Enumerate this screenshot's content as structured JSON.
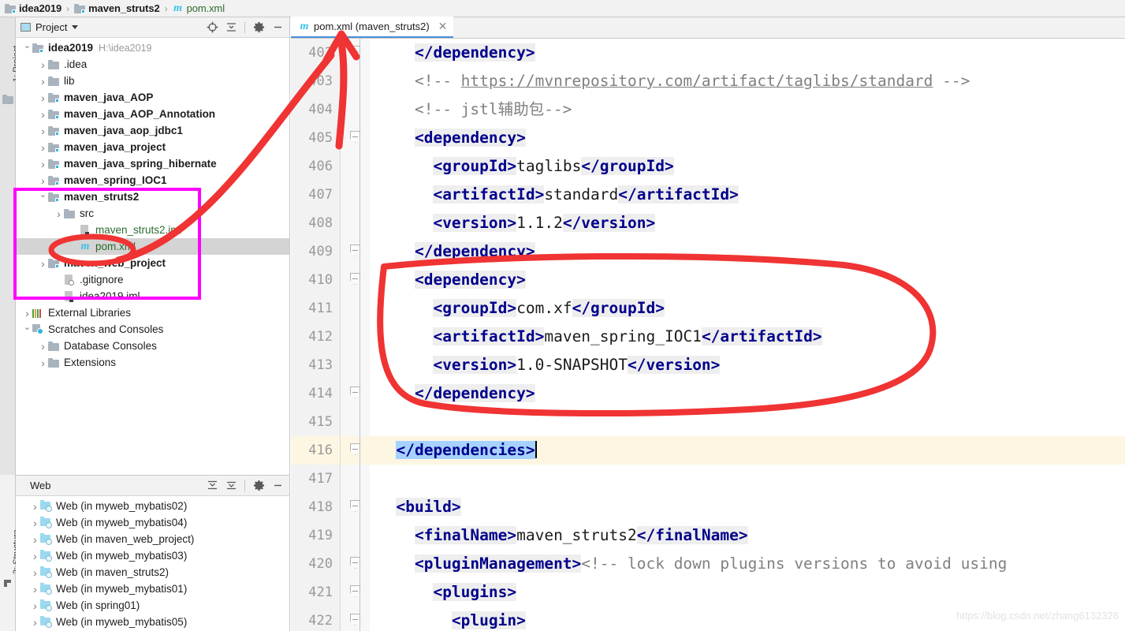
{
  "breadcrumb": {
    "items": [
      {
        "label": "idea2019",
        "icon": "folder-module-icon",
        "style": "bold"
      },
      {
        "label": "maven_struts2",
        "icon": "folder-module-icon",
        "style": "bold"
      },
      {
        "label": "pom.xml",
        "icon": "maven-icon",
        "style": "plain"
      }
    ]
  },
  "tool_strips": {
    "project": "1: Project",
    "structure": "2: Structure"
  },
  "project_panel": {
    "title": "Project",
    "toolbar": [
      {
        "name": "locate-icon",
        "glyph": "⊕"
      },
      {
        "name": "collapse-all-icon",
        "glyph": "≛"
      },
      {
        "name": "settings-gear-icon",
        "glyph": "✲"
      },
      {
        "name": "hide-icon",
        "glyph": "—"
      }
    ],
    "tree": [
      {
        "label": "idea2019",
        "path": "H:\\idea2019",
        "indent": 0,
        "arrow": "open",
        "icon": "folder-module-icon",
        "bold": true
      },
      {
        "label": ".idea",
        "indent": 1,
        "arrow": "closed",
        "icon": "folder-icon"
      },
      {
        "label": "lib",
        "indent": 1,
        "arrow": "closed",
        "icon": "folder-icon"
      },
      {
        "label": "maven_java_AOP",
        "indent": 1,
        "arrow": "closed",
        "icon": "folder-module-icon",
        "bold": true
      },
      {
        "label": "maven_java_AOP_Annotation",
        "indent": 1,
        "arrow": "closed",
        "icon": "folder-module-icon",
        "bold": true
      },
      {
        "label": "maven_java_aop_jdbc1",
        "indent": 1,
        "arrow": "closed",
        "icon": "folder-module-icon",
        "bold": true
      },
      {
        "label": "maven_java_project",
        "indent": 1,
        "arrow": "closed",
        "icon": "folder-module-icon",
        "bold": true
      },
      {
        "label": "maven_java_spring_hibernate",
        "indent": 1,
        "arrow": "closed",
        "icon": "folder-module-icon",
        "bold": true
      },
      {
        "label": "maven_spring_IOC1",
        "indent": 1,
        "arrow": "closed",
        "icon": "folder-module-icon",
        "bold": true
      },
      {
        "label": "maven_struts2",
        "indent": 1,
        "arrow": "open",
        "icon": "folder-module-icon",
        "bold": true
      },
      {
        "label": "src",
        "indent": 2,
        "arrow": "closed",
        "icon": "folder-icon"
      },
      {
        "label": "maven_struts2.iml",
        "indent": 3,
        "arrow": "none",
        "icon": "iml-file-icon",
        "green": true
      },
      {
        "label": "pom.xml",
        "indent": 3,
        "arrow": "none",
        "icon": "maven-icon",
        "green": true,
        "selected": true
      },
      {
        "label": "maven_web_project",
        "indent": 1,
        "arrow": "closed",
        "icon": "folder-module-icon",
        "bold": true
      },
      {
        "label": ".gitignore",
        "indent": 2,
        "arrow": "none",
        "icon": "gitignore-file-icon"
      },
      {
        "label": "idea2019.iml",
        "indent": 2,
        "arrow": "none",
        "icon": "iml-file-icon"
      },
      {
        "label": "External Libraries",
        "indent": 0,
        "arrow": "closed",
        "icon": "external-libraries-icon"
      },
      {
        "label": "Scratches and Consoles",
        "indent": 0,
        "arrow": "open",
        "icon": "scratches-icon"
      },
      {
        "label": "Database Consoles",
        "indent": 1,
        "arrow": "closed",
        "icon": "folder-icon"
      },
      {
        "label": "Extensions",
        "indent": 1,
        "arrow": "closed",
        "icon": "folder-icon"
      }
    ]
  },
  "web_panel": {
    "title": "Web",
    "toolbar": [
      {
        "name": "expand-all-icon",
        "glyph": "≛"
      },
      {
        "name": "collapse-all-icon",
        "glyph": "≛"
      },
      {
        "name": "settings-gear-icon",
        "glyph": "✲"
      },
      {
        "name": "hide-icon",
        "glyph": "—"
      }
    ],
    "items": [
      "Web (in myweb_mybatis02)",
      "Web (in myweb_mybatis04)",
      "Web (in maven_web_project)",
      "Web (in myweb_mybatis03)",
      "Web (in maven_struts2)",
      "Web (in myweb_mybatis01)",
      "Web (in spring01)",
      "Web (in myweb_mybatis05)"
    ]
  },
  "editor": {
    "tab": {
      "label": "pom.xml (maven_struts2)",
      "icon": "maven-icon",
      "close": "✕"
    },
    "lines": [
      {
        "n": "402",
        "fold": "tip",
        "segments": [
          {
            "t": "    ",
            "c": "plain"
          },
          {
            "t": "</dependency>",
            "c": "tag"
          }
        ]
      },
      {
        "n": "403",
        "segments": [
          {
            "t": "    ",
            "c": "plain"
          },
          {
            "t": "<!-- ",
            "c": "comment"
          },
          {
            "t": "https://mvnrepository.com/artifact/taglibs/standard",
            "c": "comment-url"
          },
          {
            "t": " -->",
            "c": "comment"
          }
        ]
      },
      {
        "n": "404",
        "segments": [
          {
            "t": "    ",
            "c": "plain"
          },
          {
            "t": "<!-- jstl辅助包-->",
            "c": "comment"
          }
        ]
      },
      {
        "n": "405",
        "fold": "tip",
        "segments": [
          {
            "t": "    ",
            "c": "plain"
          },
          {
            "t": "<dependency>",
            "c": "tag"
          }
        ]
      },
      {
        "n": "406",
        "segments": [
          {
            "t": "      ",
            "c": "plain"
          },
          {
            "t": "<groupId>",
            "c": "tag"
          },
          {
            "t": "taglibs",
            "c": "plain"
          },
          {
            "t": "</groupId>",
            "c": "tag"
          }
        ]
      },
      {
        "n": "407",
        "segments": [
          {
            "t": "      ",
            "c": "plain"
          },
          {
            "t": "<artifactId>",
            "c": "tag"
          },
          {
            "t": "standard",
            "c": "plain"
          },
          {
            "t": "</artifactId>",
            "c": "tag"
          }
        ]
      },
      {
        "n": "408",
        "segments": [
          {
            "t": "      ",
            "c": "plain"
          },
          {
            "t": "<version>",
            "c": "tag"
          },
          {
            "t": "1.1.2",
            "c": "plain"
          },
          {
            "t": "</version>",
            "c": "tag"
          }
        ]
      },
      {
        "n": "409",
        "fold": "tip",
        "segments": [
          {
            "t": "    ",
            "c": "plain"
          },
          {
            "t": "</dependency>",
            "c": "tag"
          }
        ]
      },
      {
        "n": "410",
        "fold": "tip",
        "segments": [
          {
            "t": "    ",
            "c": "plain"
          },
          {
            "t": "<dependency>",
            "c": "tag"
          }
        ]
      },
      {
        "n": "411",
        "segments": [
          {
            "t": "      ",
            "c": "plain"
          },
          {
            "t": "<groupId>",
            "c": "tag"
          },
          {
            "t": "com.xf",
            "c": "plain"
          },
          {
            "t": "</groupId>",
            "c": "tag"
          }
        ]
      },
      {
        "n": "412",
        "segments": [
          {
            "t": "      ",
            "c": "plain"
          },
          {
            "t": "<artifactId>",
            "c": "tag"
          },
          {
            "t": "maven_spring_IOC1",
            "c": "plain"
          },
          {
            "t": "</artifactId>",
            "c": "tag"
          }
        ]
      },
      {
        "n": "413",
        "segments": [
          {
            "t": "      ",
            "c": "plain"
          },
          {
            "t": "<version>",
            "c": "tag"
          },
          {
            "t": "1.0-SNAPSHOT",
            "c": "plain"
          },
          {
            "t": "</version>",
            "c": "tag"
          }
        ]
      },
      {
        "n": "414",
        "fold": "tip",
        "segments": [
          {
            "t": "    ",
            "c": "plain"
          },
          {
            "t": "</dependency>",
            "c": "tag"
          }
        ]
      },
      {
        "n": "415",
        "segments": []
      },
      {
        "n": "416",
        "highlight": true,
        "fold": "tip",
        "segments": [
          {
            "t": "  ",
            "c": "plain"
          },
          {
            "t": "</dependencies>",
            "c": "tag-selected"
          },
          {
            "t": "",
            "c": "caret"
          }
        ]
      },
      {
        "n": "417",
        "segments": []
      },
      {
        "n": "418",
        "fold": "tip",
        "segments": [
          {
            "t": "  ",
            "c": "plain"
          },
          {
            "t": "<build>",
            "c": "tag"
          }
        ]
      },
      {
        "n": "419",
        "segments": [
          {
            "t": "    ",
            "c": "plain"
          },
          {
            "t": "<finalName>",
            "c": "tag"
          },
          {
            "t": "maven_struts2",
            "c": "plain"
          },
          {
            "t": "</finalName>",
            "c": "tag"
          }
        ]
      },
      {
        "n": "420",
        "fold": "tip",
        "segments": [
          {
            "t": "    ",
            "c": "plain"
          },
          {
            "t": "<pluginManagement>",
            "c": "tag"
          },
          {
            "t": "<!-- lock down plugins versions to avoid using",
            "c": "comment"
          }
        ]
      },
      {
        "n": "421",
        "fold": "tip",
        "segments": [
          {
            "t": "      ",
            "c": "plain"
          },
          {
            "t": "<plugins>",
            "c": "tag"
          }
        ]
      },
      {
        "n": "422",
        "fold": "tip",
        "segments": [
          {
            "t": "        ",
            "c": "plain"
          },
          {
            "t": "<plugin>",
            "c": "tag"
          }
        ]
      }
    ],
    "watermark": "https://blog.csdn.net/zhang6132326"
  },
  "annotations": {
    "magenta_box_color": "#ff00ff",
    "red_marker_color": "#f03333",
    "items": [
      {
        "name": "magenta-highlight-box",
        "target": "maven_struts2 project subtree"
      },
      {
        "name": "red-circle-pom-xml",
        "target": "pom.xml tree node"
      },
      {
        "name": "red-arrow-to-tab",
        "target": "pom.xml editor tab"
      },
      {
        "name": "red-ellipse-dependency",
        "target": "lines 410-414 dependency block"
      }
    ]
  }
}
